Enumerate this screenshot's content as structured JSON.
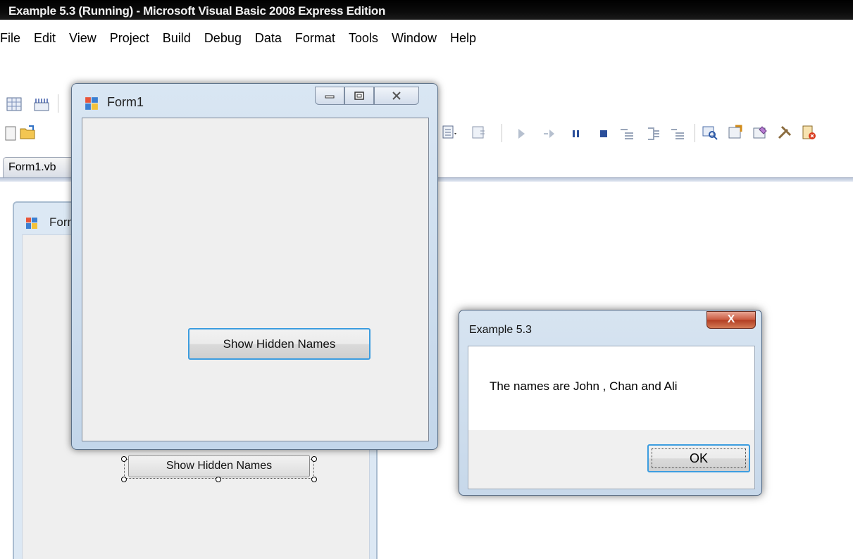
{
  "ide": {
    "title": "Example 5.3 (Running) - Microsoft Visual Basic 2008 Express Edition",
    "menu": [
      "File",
      "Edit",
      "View",
      "Project",
      "Build",
      "Debug",
      "Data",
      "Format",
      "Tools",
      "Window",
      "Help"
    ],
    "doc_tab": "Form1.vb"
  },
  "toolbar_icons": [
    "format-grid-icon",
    "align-icon",
    "new-project-icon",
    "open-folder-icon",
    "list-dropdown-icon",
    "start-debug-icon",
    "step-into-icon",
    "break-all-icon",
    "stop-icon",
    "comment-icon",
    "uncomment-icon",
    "solution-explorer-icon",
    "properties-icon",
    "object-browser-icon",
    "toolbox-icon",
    "error-list-icon"
  ],
  "designer": {
    "title": "Form1",
    "button_label": "Show Hidden Names"
  },
  "form1": {
    "title": "Form1",
    "button_label": "Show Hidden Names"
  },
  "msgbox": {
    "title": "Example 5.3",
    "message": "The names are John , Chan and Ali",
    "ok_label": "OK",
    "close_glyph": "X"
  }
}
